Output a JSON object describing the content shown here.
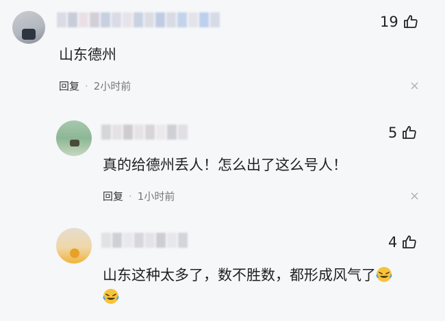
{
  "comments": [
    {
      "text": "山东德州",
      "reply_label": "回复",
      "separator": "·",
      "time": "2小时前",
      "likes": "19",
      "close_symbol": "×",
      "icons": {
        "like": "thumbs-up-icon",
        "close": "close-icon"
      }
    },
    {
      "text": "真的给德州丢人！怎么出了这么号人！",
      "reply_label": "回复",
      "separator": "·",
      "time": "1小时前",
      "likes": "5",
      "close_symbol": "×",
      "icons": {
        "like": "thumbs-up-icon",
        "close": "close-icon"
      }
    },
    {
      "text_line1": "山东这种太多了，数不胜数，都形成风气了",
      "likes": "4",
      "icons": {
        "like": "thumbs-up-icon",
        "emoji": "laughing-crying-emoji-icon"
      }
    }
  ],
  "colors": {
    "background": "#f6f7f9",
    "text": "#1f1f1f",
    "meta": "#777777",
    "close": "#b0b3b8",
    "emoji": "#f6c43a"
  }
}
